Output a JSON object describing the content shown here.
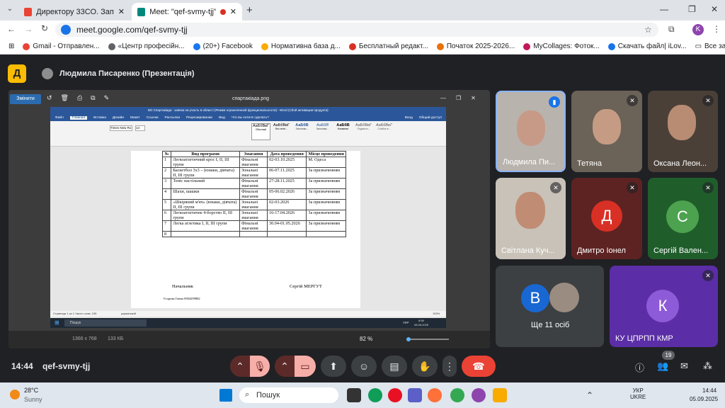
{
  "browser": {
    "tabs": [
      {
        "title": "Директору 33СО. Запрошення",
        "active": false
      },
      {
        "title": "Meet: \"qef-svmy-tjj\"",
        "active": true
      }
    ],
    "new_tab": "+",
    "url": "meet.google.com/qef-svmy-tjj",
    "profile_letter": "K",
    "bookmarks": [
      "Gmail - Отправлен...",
      "«Центр професійн...",
      "(20+) Facebook",
      "Нормативна база д...",
      "Бесплатный редакт...",
      "Початок 2025-2026...",
      "MyCollages: Фоток...",
      "Скачать файл| iLov..."
    ],
    "all_bookmarks": "Все закладки"
  },
  "meet": {
    "presenter": "Людмила Писаренко (Презентація)",
    "meeting_code": "qef-svmy-tjj",
    "time": "14:44",
    "participants_count": "19",
    "people": [
      {
        "name": "Людмила Пи...",
        "speaking": true
      },
      {
        "name": "Тетяна",
        "muted": true
      },
      {
        "name": "Оксана Леон...",
        "muted": true
      },
      {
        "name": "Світлана Куч...",
        "muted": true
      },
      {
        "name": "Дмитро Іонел",
        "letter": "Д",
        "muted": true
      },
      {
        "name": "Сергій Вален...",
        "letter": "С",
        "muted": true
      },
      {
        "name": "Ще 11 осіб",
        "letter": "В"
      },
      {
        "name": "КУ ЦПРПП КМР",
        "letter": "К",
        "muted": true
      }
    ]
  },
  "viewer": {
    "title": "спартакіада.png",
    "edit_button": "Змінити",
    "size": "1366 x 768",
    "filesize": "133 КБ",
    "zoom": "82 %"
  },
  "word": {
    "title": "ВО Спартакіада - заявка на участь в області (Режим ограниченной функциональности) - Word (Сбой активации продукта)",
    "menu": [
      "Файл",
      "Главная",
      "Вставка",
      "Дизайн",
      "Макет",
      "Ссылки",
      "Рассылки",
      "Рецензирование",
      "Вид",
      "Что вы хотите сделать?",
      "Вход",
      "Общий доступ"
    ],
    "font": "Times New Ro",
    "font_size": "14",
    "styles": [
      "АаБбВвГ",
      "АаБбВвГ",
      "АаБбВ",
      "АаБбВ",
      "АаБбВ",
      "АаБбВвГ",
      "АаБбВеГ"
    ],
    "style_names": [
      "Обычный",
      "Без инте...",
      "Заголово...",
      "Заголово...",
      "Название",
      "Подзагол...",
      "Слабое в..."
    ],
    "status_left": "Страница 1 из 1   Число слов: 155",
    "status_lang": "украинский",
    "status_zoom": "100%",
    "table_headers": [
      "№",
      "Вид програми",
      "Змагання",
      "Дата проведення",
      "Місце проведення"
    ],
    "rows": [
      [
        "1",
        "Легкоатлетичний крос І, ІІ, ІІІ групи",
        "Фінальні змагання",
        "02-03.10.2025",
        "М. Одеса"
      ],
      [
        "2",
        "Баскетбол 3х3 – (юнаки, дівчата) ІІ, ІІІ групи",
        "Зональні змагання",
        "06-07.11.2025",
        "За призначенням"
      ],
      [
        "3",
        "Теніс настільний",
        "Фінальні змагання",
        "27-28.11.2025",
        "За призначенням"
      ],
      [
        "4",
        "Шахи, шашки",
        "Фінальні змагання",
        "05-06.02.2026",
        "За призначенням"
      ],
      [
        "5",
        "«Шкіряний м'яч» (юнаки, дівчата) ІІ, ІІІ групи",
        "Зональні змагання",
        "02-03.2026",
        "За призначенням"
      ],
      [
        "6",
        "Легкоатлетичне 4-борство ІІ, ІІІ групи",
        "Зональні змагання",
        "16-17.04.2026",
        "За призначенням"
      ],
      [
        "7",
        "Легка атлетика І, ІІ, ІІІ групи",
        "Фінальні змагання",
        "30.04-01.05.2026",
        "За призначенням"
      ],
      [
        "8",
        "",
        "",
        "",
        ""
      ]
    ],
    "signer_title": "Начальник",
    "signer_name": "Сергій МЕРГУТ",
    "contact": "Єгорова Ганна 0904299882"
  },
  "inner_taskbar": {
    "search": "Пошук",
    "lang": "УКР",
    "time": "8:58",
    "date": "08.08.2025"
  },
  "taskbar": {
    "weather_temp": "28°C",
    "weather_desc": "Sunny",
    "search": "Пошук",
    "lang1": "УКР",
    "lang2": "UKRE",
    "time": "14:44",
    "date": "05.09.2025"
  }
}
